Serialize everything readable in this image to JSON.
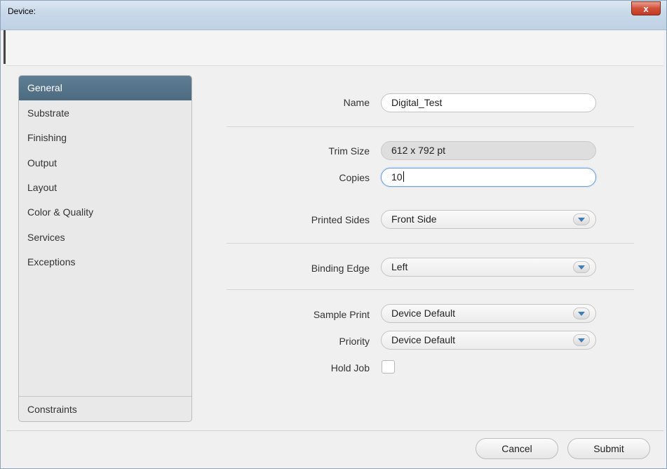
{
  "window": {
    "title": "Device:",
    "close_label": "x"
  },
  "sidebar": {
    "items": [
      {
        "label": "General",
        "active": true
      },
      {
        "label": "Substrate",
        "active": false
      },
      {
        "label": "Finishing",
        "active": false
      },
      {
        "label": "Output",
        "active": false
      },
      {
        "label": "Layout",
        "active": false
      },
      {
        "label": "Color & Quality",
        "active": false
      },
      {
        "label": "Services",
        "active": false
      },
      {
        "label": "Exceptions",
        "active": false
      }
    ],
    "bottom_item": "Constraints"
  },
  "form": {
    "name": {
      "label": "Name",
      "value": "Digital_Test"
    },
    "trim_size": {
      "label": "Trim Size",
      "value": "612 x 792 pt"
    },
    "copies": {
      "label": "Copies",
      "value": "10"
    },
    "printed_sides": {
      "label": "Printed Sides",
      "value": "Front Side"
    },
    "binding_edge": {
      "label": "Binding Edge",
      "value": "Left"
    },
    "sample_print": {
      "label": "Sample Print",
      "value": "Device Default"
    },
    "priority": {
      "label": "Priority",
      "value": "Device Default"
    },
    "hold_job": {
      "label": "Hold Job",
      "checked": false
    }
  },
  "footer": {
    "cancel_label": "Cancel",
    "submit_label": "Submit"
  },
  "colors": {
    "active_item": "#54728a",
    "focus_border": "#6fa0d6",
    "chevron": "#3f7fb8"
  }
}
